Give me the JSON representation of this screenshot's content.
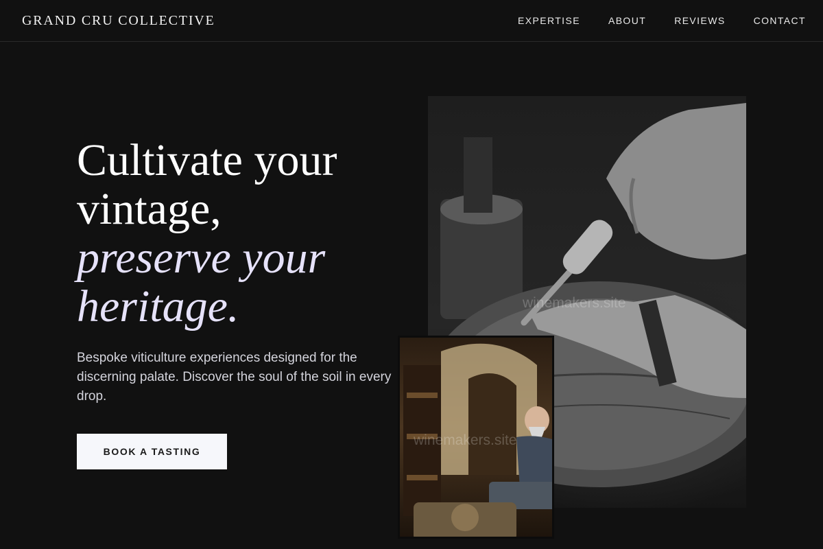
{
  "header": {
    "brand": "GRAND CRU COLLECTIVE",
    "nav": [
      "EXPERTISE",
      "ABOUT",
      "REVIEWS",
      "CONTACT"
    ]
  },
  "hero": {
    "title_line1": "Cultivate your",
    "title_line2": "vintage,",
    "title_line3": "preserve your",
    "title_line4": "heritage.",
    "description": "Bespoke viticulture experiences designed for the discerning palate. Discover the soul of the soil in every drop.",
    "cta_label": "BOOK A TASTING"
  },
  "images": {
    "main_watermark": "winemakers.site",
    "small_watermark": "winemakers.site"
  },
  "colors": {
    "background": "#111111",
    "accent_text": "#e6e2fa",
    "button_bg": "#f6f7fb"
  }
}
